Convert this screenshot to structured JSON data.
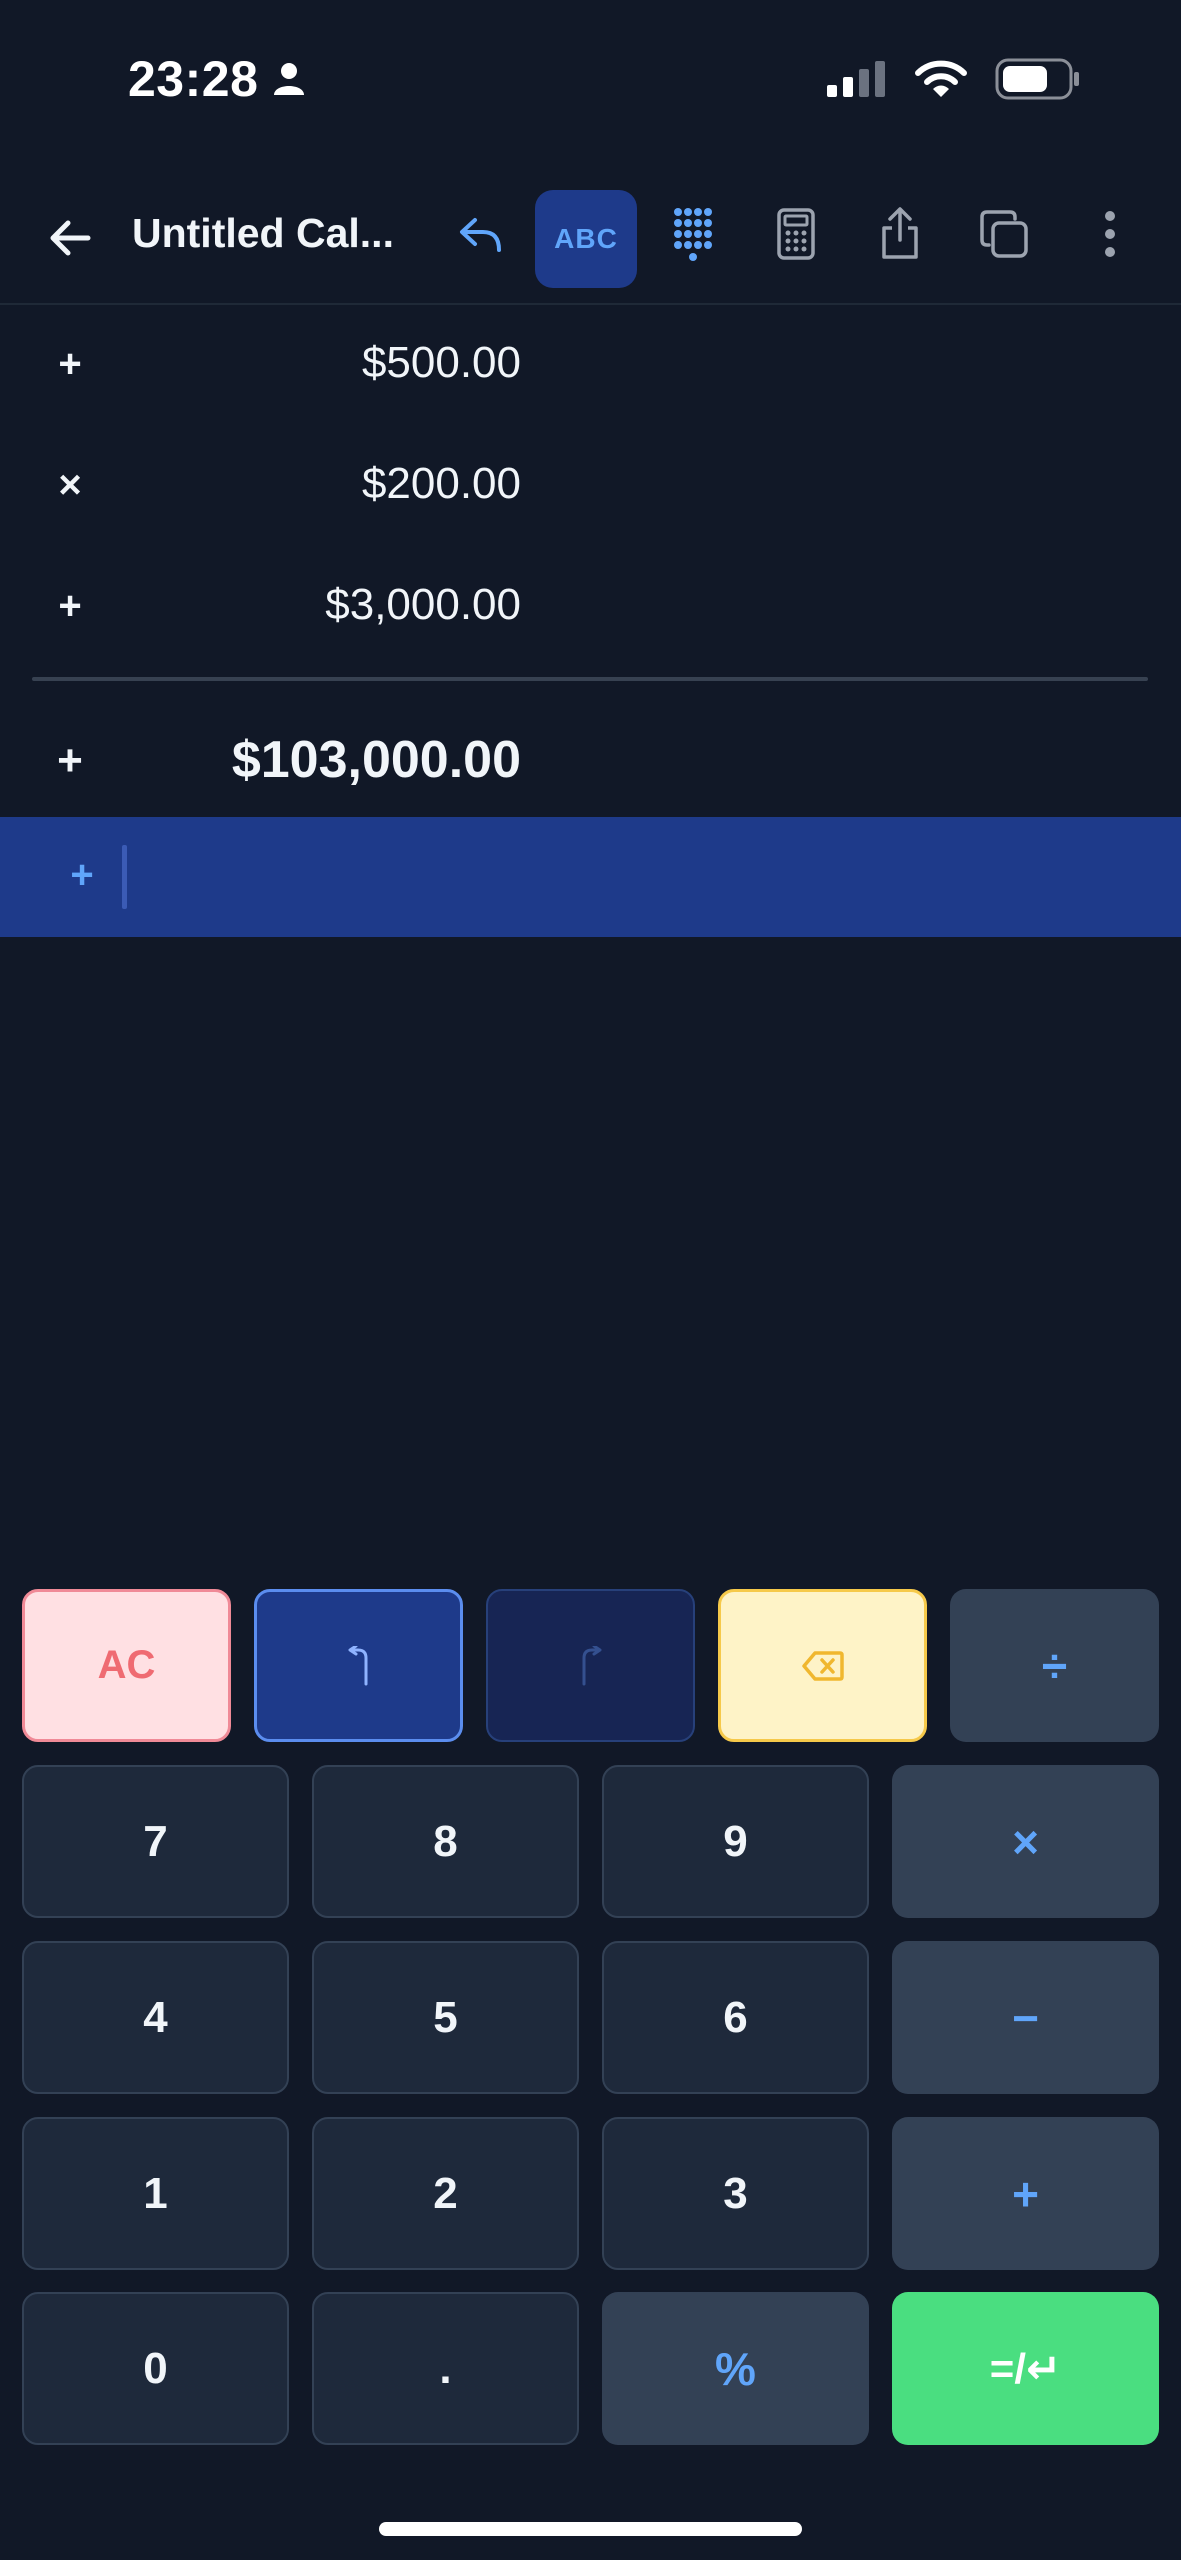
{
  "status_bar": {
    "time": "23:28",
    "icons": [
      "person-icon",
      "signal-icon",
      "wifi-icon",
      "battery-icon"
    ]
  },
  "toolbar": {
    "title": "Untitled Cal...",
    "abc_label": "ABC",
    "icons": [
      "back-arrow-icon",
      "undo-arrow-icon",
      "abc-toggle",
      "keypad-icon",
      "calculator-icon",
      "share-icon",
      "duplicate-icon",
      "more-vertical-icon"
    ]
  },
  "tape": {
    "rows": [
      {
        "op": "+",
        "amount": "$500.00"
      },
      {
        "op": "×",
        "amount": "$200.00"
      },
      {
        "op": "+",
        "amount": "$3,000.00"
      }
    ],
    "total": {
      "op": "+",
      "amount": "$103,000.00"
    },
    "active_row": {
      "op": "+",
      "value": ""
    }
  },
  "keypad": {
    "ac": "AC",
    "divide": "÷",
    "multiply": "×",
    "minus": "−",
    "plus": "+",
    "percent": "%",
    "equals": "=/↵",
    "dot": ".",
    "digits": {
      "d7": "7",
      "d8": "8",
      "d9": "9",
      "d4": "4",
      "d5": "5",
      "d6": "6",
      "d1": "1",
      "d2": "2",
      "d3": "3",
      "d0": "0"
    }
  },
  "colors": {
    "background": "#111827",
    "accent_blue": "#60a5fa",
    "active_row": "#1e3a8a",
    "equals_green": "#4ade80",
    "ac_red": "#ef6b72",
    "delete_yellow": "#f6c94a"
  }
}
